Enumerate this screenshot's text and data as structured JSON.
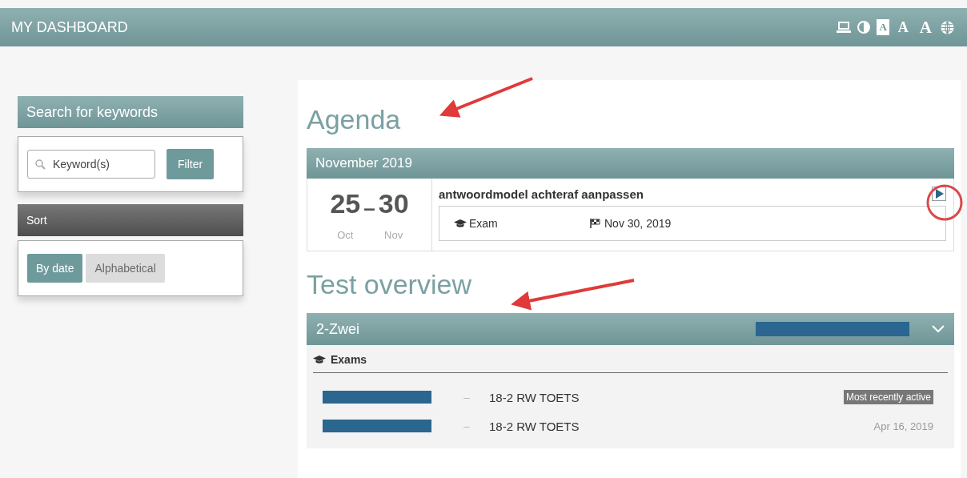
{
  "header": {
    "title": "MY DASHBOARD",
    "font_sizes": [
      {
        "label": "A",
        "selected": true
      },
      {
        "label": "A",
        "selected": false
      },
      {
        "label": "A",
        "selected": false
      }
    ]
  },
  "search": {
    "title": "Search for keywords",
    "placeholder": "Keyword(s)",
    "button": "Filter"
  },
  "sort": {
    "title": "Sort",
    "options": [
      {
        "label": "By date",
        "selected": true
      },
      {
        "label": "Alphabetical",
        "selected": false
      }
    ]
  },
  "agenda": {
    "heading": "Agenda",
    "month": "November 2019",
    "items": [
      {
        "start_day": "25",
        "separator": "–",
        "end_day": "30",
        "start_month": "Oct",
        "end_month": "Nov",
        "title": "antwoordmodel achteraf aanpassen",
        "type": "Exam",
        "due": "Nov 30, 2019"
      }
    ]
  },
  "tests": {
    "heading": "Test overview",
    "groups": [
      {
        "name": "2-Zwei",
        "expanded": true,
        "section": "Exams",
        "rows": [
          {
            "dash": "–",
            "title": "18-2 RW TOETS",
            "kind": "badge",
            "status": "Most recently active"
          },
          {
            "dash": "–",
            "title": "18-2 RW TOETS",
            "kind": "date",
            "status": "Apr 16, 2019"
          }
        ]
      }
    ]
  }
}
